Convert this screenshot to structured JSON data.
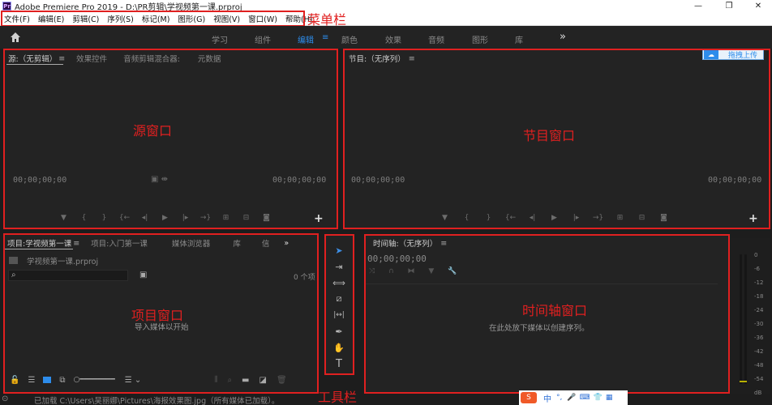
{
  "titlebar": {
    "logo": "Pr",
    "title": "Adobe Premiere Pro 2019 - D:\\PR剪辑\\学视频第一课.prproj",
    "minimize": "—",
    "maximize": "❐",
    "close": "✕"
  },
  "menubar": {
    "items": [
      "文件(F)",
      "编辑(E)",
      "剪辑(C)",
      "序列(S)",
      "标记(M)",
      "图形(G)",
      "视图(V)",
      "窗口(W)",
      "帮助(H)"
    ]
  },
  "annotations": {
    "menubar": "菜单栏",
    "source": "源窗口",
    "program": "节目窗口",
    "project": "项目窗口",
    "timeline": "时间轴窗口",
    "tools": "工具栏"
  },
  "workspaces": {
    "items": [
      "学习",
      "组件",
      "编辑",
      "颜色",
      "效果",
      "音频",
      "图形",
      "库"
    ],
    "active": "编辑",
    "menu_glyph": "≡",
    "more": "»"
  },
  "upload_badge": {
    "label": "拖拽上传"
  },
  "source_panel": {
    "tabs": [
      "源:（无剪辑）",
      "效果控件",
      "音频剪辑混合器:",
      "元数据"
    ],
    "tab_menu": "≡",
    "timecode_left": "00;00;00;00",
    "timecode_right": "00;00;00;00"
  },
  "program_panel": {
    "tab": "节目:（无序列）",
    "tab_menu": "≡",
    "timecode_left": "00;00;00;00",
    "timecode_right": "00;00;00;00"
  },
  "transport": {
    "icons": [
      "marker-icon",
      "mark-in-icon",
      "mark-out-icon",
      "go-to-in-icon",
      "step-back-icon",
      "play-icon",
      "step-forward-icon",
      "go-to-out-icon",
      "insert-icon",
      "overwrite-icon",
      "export-frame-icon"
    ],
    "glyphs": [
      "▼",
      "{",
      "}",
      "{←",
      "◂|",
      "▶",
      "|▸",
      "→}",
      "⊞",
      "⊟",
      "◙"
    ],
    "add": "+"
  },
  "project_panel": {
    "tabs": [
      "项目:学视频第一课",
      "项目:入门第一课",
      "媒体浏览器",
      "库",
      "信"
    ],
    "tab_menu": "≡",
    "more": "»",
    "file_name": "学视频第一课.prproj",
    "search_placeholder": "",
    "item_count": "0 个项",
    "hint": "导入媒体以开始"
  },
  "tools": {
    "items": [
      "selection-tool",
      "track-select-tool",
      "ripple-edit-tool",
      "razor-tool",
      "slip-tool",
      "pen-tool",
      "hand-tool",
      "type-tool"
    ],
    "glyphs": [
      "➤",
      "⇥",
      "⟺",
      "⧄",
      "|↔|",
      "✒",
      "✋",
      "T"
    ]
  },
  "timeline_panel": {
    "tab": "时间轴:（无序列）",
    "tab_menu": "≡",
    "timecode": "00;00;00;00",
    "hint": "在此处放下媒体以创建序列。"
  },
  "audio_meter": {
    "labels": [
      "0",
      "-6",
      "-12",
      "-18",
      "-24",
      "-30",
      "-36",
      "-42",
      "-48",
      "-54",
      "dB"
    ]
  },
  "statusbar": {
    "text": "已加载 C:\\Users\\吴丽娜\\Pictures\\海报效果图.jpg（所有媒体已加载）。"
  },
  "ime": {
    "items": [
      "中",
      "°,",
      "🎤",
      "⌨",
      "👕",
      "▦"
    ]
  },
  "colors": {
    "accent": "#2d8ceb",
    "annotation": "#e02020",
    "panel": "#232323",
    "background": "#1d1d1d"
  }
}
